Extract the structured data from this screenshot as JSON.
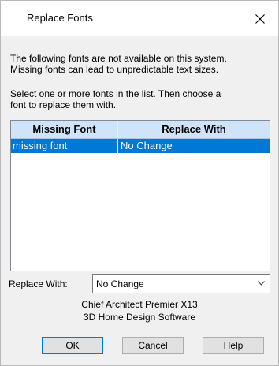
{
  "window": {
    "title": "Replace Fonts",
    "close_icon": "close-icon"
  },
  "messages": {
    "line1": "The following fonts are not available on this system.",
    "line2": "Missing fonts can lead to unpredictable text sizes.",
    "line3": "Select one or more fonts in the list.  Then choose a",
    "line4": "font to replace them with."
  },
  "font_list": {
    "columns": [
      "Missing Font",
      "Replace With"
    ],
    "rows": [
      {
        "missing": "missing font",
        "replace": "No Change",
        "selected": true
      }
    ],
    "selected_color": "#0078d7",
    "header_color": "#cfe4f8"
  },
  "replace_with": {
    "label": "Replace With:",
    "value": "No Change",
    "arrow_icon": "chevron-down-icon"
  },
  "app_info": {
    "product": "Chief Architect Premier X13",
    "tagline": "3D Home Design Software"
  },
  "buttons": {
    "ok": "OK",
    "cancel": "Cancel",
    "help": "Help"
  }
}
